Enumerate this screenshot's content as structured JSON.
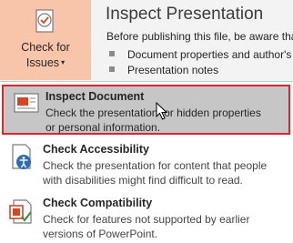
{
  "check_button": {
    "line1": "Check for",
    "line2": "Issues",
    "caret": "▾"
  },
  "inspect_section": {
    "title": "Inspect Presentation",
    "description": "Before publishing this file, be aware tha",
    "bullets": [
      "Document properties and author's",
      "Presentation notes"
    ]
  },
  "menu": {
    "items": [
      {
        "title": "Inspect Document",
        "desc_line1": "Check the presentation for hidden properties",
        "desc_line2": "or personal information.",
        "icon": "inspect-document-icon"
      },
      {
        "title": "Check Accessibility",
        "desc_line1": "Check the presentation for content that people",
        "desc_line2": "with disabilities might find difficult to read.",
        "icon": "accessibility-icon"
      },
      {
        "title": "Check Compatibility",
        "desc_line1": "Check for features not supported by earlier",
        "desc_line2": "versions of PowerPoint.",
        "icon": "compatibility-icon"
      }
    ]
  },
  "colors": {
    "button_bg": "#f8c5ab",
    "highlight_bg": "#c6c6c6",
    "highlight_border": "#e0242b",
    "accent": "#d24726"
  }
}
